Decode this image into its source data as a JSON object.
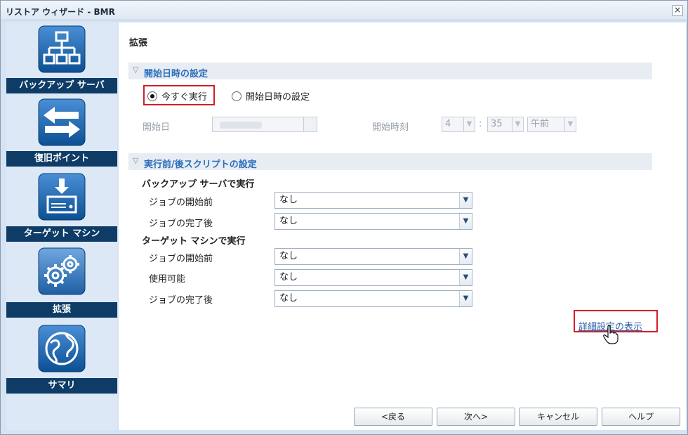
{
  "window": {
    "title": "リストア ウィザード - BMR",
    "close_label": "×"
  },
  "sidebar": {
    "items": [
      {
        "label": "バックアップ サーバ",
        "icon": "network-tree-icon"
      },
      {
        "label": "復旧ポイント",
        "icon": "swap-arrows-icon"
      },
      {
        "label": "ターゲット マシン",
        "icon": "drive-download-icon"
      },
      {
        "label": "拡張",
        "icon": "gears-icon"
      },
      {
        "label": "サマリ",
        "icon": "globe-icon"
      }
    ],
    "active": "拡張"
  },
  "main": {
    "page_title": "拡張",
    "start_section": {
      "header": "開始日時の設定",
      "radio_now": "今すぐ実行",
      "radio_schedule": "開始日時の設定",
      "selected": "今すぐ実行",
      "date_label": "開始日",
      "time_label": "開始時刻",
      "hour": "4",
      "minute": "35",
      "ampm": "午前",
      "separator": ":"
    },
    "script_section": {
      "header": "実行前/後スクリプトの設定",
      "backup_server_group": "バックアップ サーバで実行",
      "target_group": "ターゲット マシンで実行",
      "rows_backup": [
        {
          "label": "ジョブの開始前",
          "value": "なし"
        },
        {
          "label": "ジョブの完了後",
          "value": "なし"
        }
      ],
      "rows_target": [
        {
          "label": "ジョブの開始前",
          "value": "なし"
        },
        {
          "label": "使用可能",
          "value": "なし"
        },
        {
          "label": "ジョブの完了後",
          "value": "なし"
        }
      ]
    },
    "advanced_link": "詳細設定の表示"
  },
  "buttons": {
    "back": "<戻る",
    "next": "次へ>",
    "cancel": "キャンセル",
    "help": "ヘルプ"
  },
  "colors": {
    "nav_label_bg": "#0e3c66",
    "accent": "#2a6ebb",
    "highlight_border": "#d21f2a"
  }
}
